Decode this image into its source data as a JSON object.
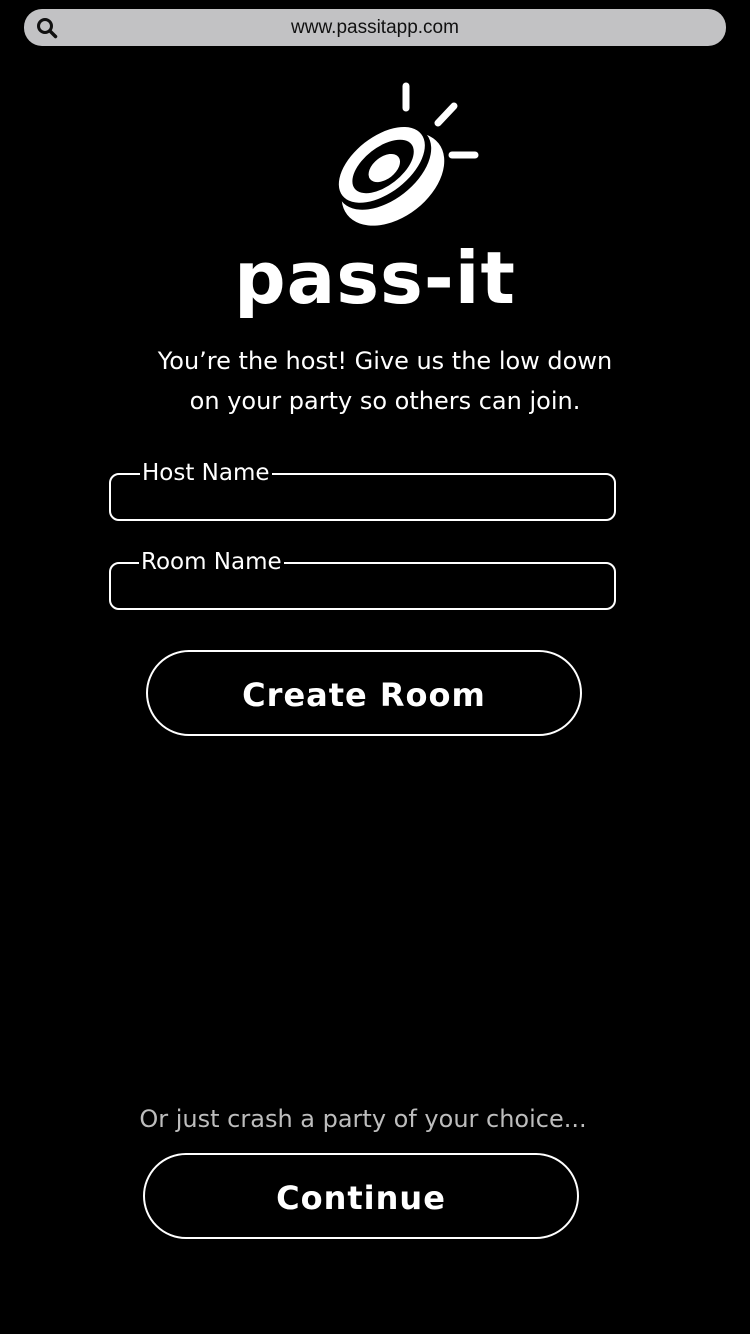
{
  "browser": {
    "url": "www.passitapp.com",
    "search_icon": "search-icon"
  },
  "logo": {
    "icon": "speaker-icon",
    "brand_name": "pass-it"
  },
  "intro": {
    "line1": "You’re the host! Give us the low down",
    "line2": "on your party so others can join."
  },
  "form": {
    "host_name_label": "Host Name",
    "host_name_value": "",
    "room_name_label": "Room Name",
    "room_name_value": "",
    "create_button_label": "Create Room"
  },
  "alternate": {
    "prompt": "Or just crash a party of your choice...",
    "continue_button_label": "Continue"
  },
  "colors": {
    "background": "#000000",
    "foreground": "#ffffff",
    "url_bar": "#c2c2c4",
    "muted_text": "#bdbdbd"
  }
}
